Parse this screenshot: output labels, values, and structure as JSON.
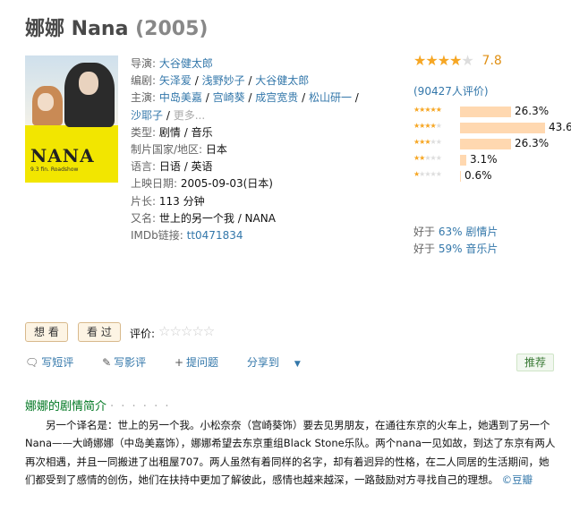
{
  "header": {
    "title": "娜娜 Nana",
    "year": "(2005)"
  },
  "poster": {
    "logo": "NANA",
    "tagline": "9.3 fin. Roadshow"
  },
  "info": {
    "director_label": "导演:",
    "director": "大谷健太郎",
    "writer_label": "编剧:",
    "writers": [
      "矢泽爱",
      "浅野妙子",
      "大谷健太郎"
    ],
    "cast_label": "主演:",
    "cast": [
      "中岛美嘉",
      "宫崎葵",
      "成宫宽贵",
      "松山研一",
      "沙耶子"
    ],
    "more": "更多...",
    "genre_label": "类型:",
    "genres": [
      "剧情",
      "音乐"
    ],
    "country_label": "制片国家/地区:",
    "country": "日本",
    "language_label": "语言:",
    "languages": "日语 / 英语",
    "release_label": "上映日期:",
    "release": "2005-09-03(日本)",
    "runtime_label": "片长:",
    "runtime": "113 分钟",
    "aka_label": "又名:",
    "aka": "世上的另一个我 / NANA",
    "imdb_label": "IMDb链接:",
    "imdb": "tt0471834"
  },
  "rating": {
    "score": "7.8",
    "stars_filled": 4,
    "votes": "(90427人评价)",
    "distribution": [
      {
        "stars": 5,
        "pct": "26.3%",
        "value": 26.3
      },
      {
        "stars": 4,
        "pct": "43.6%",
        "value": 43.6
      },
      {
        "stars": 3,
        "pct": "26.3%",
        "value": 26.3
      },
      {
        "stars": 2,
        "pct": "3.1%",
        "value": 3.1
      },
      {
        "stars": 1,
        "pct": "0.6%",
        "value": 0.6
      }
    ],
    "better_than": [
      {
        "prefix": "好于 ",
        "link": "63% 剧情片"
      },
      {
        "prefix": "好于 ",
        "link": "59% 音乐片"
      }
    ]
  },
  "actions": {
    "want": "想 看",
    "seen": "看 过",
    "rate_label": "评价:",
    "write_review_short": "写短评",
    "write_review": "写影评",
    "ask": "提问题",
    "share": "分享到",
    "recommend": "推荐"
  },
  "synopsis": {
    "title": "娜娜的剧情简介",
    "dots": "· · · · · ·",
    "text": "另一个译名是：世上的另一个我。小松奈奈（宫崎葵饰）要去见男朋友，在通往东京的火车上，她遇到了另一个Nana——大崎娜娜（中岛美嘉饰），娜娜希望去东京重组Black Stone乐队。两个nana一见如故，到达了东京有两人再次相遇，并且一同搬进了出租屋707。两人虽然有着同样的名字，却有着迥异的性格，在二人同居的生活期间，她们都受到了感情的创伤，她们在扶持中更加了解彼此，感情也越来越深，一路鼓励对方寻找自己的理想。",
    "source": "©豆瓣"
  }
}
